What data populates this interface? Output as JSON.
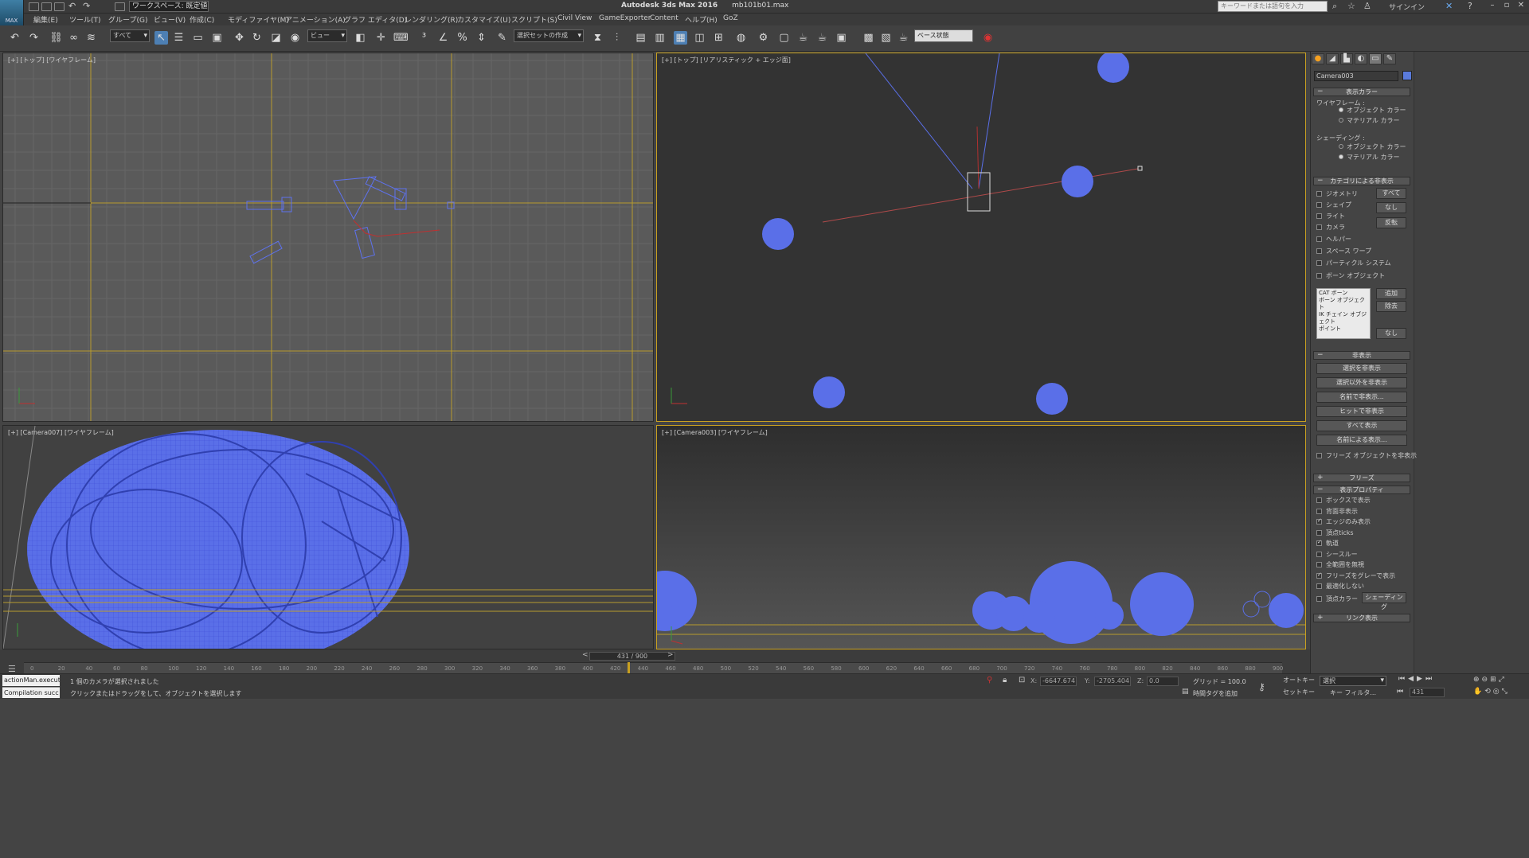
{
  "app": {
    "logo_text": "MAX",
    "workspace": "ワークスペース: 既定値",
    "title": "Autodesk 3ds Max 2016",
    "filename": "mb101b01.max",
    "search_placeholder": "キーワードまたは語句を入力",
    "signin": "サインイン"
  },
  "menu": [
    "編集(E)",
    "ツール(T)",
    "グループ(G)",
    "ビュー(V)",
    "作成(C)",
    "モディファイヤ(M)",
    "アニメーション(A)",
    "グラフ エディタ(D)",
    "レンダリング(R)",
    "カスタマイズ(U)",
    "スクリプト(S)",
    "Civil View",
    "GameExporter",
    "Content",
    "ヘルプ(H)",
    "GoZ"
  ],
  "toolbar": {
    "filter": "すべて",
    "view": "ビュー",
    "selection_set": "選択セットの作成",
    "render_state": "ベース状態"
  },
  "viewports": {
    "top_left": "[+] [トップ] [ワイヤフレーム]",
    "top_right": "[+] [トップ] [リアリスティック + エッジ面]",
    "bottom_left": "[+] [Camera007] [ワイヤフレーム]",
    "bottom_right": "[+] [Camera003] [ワイヤフレーム]"
  },
  "colors": {
    "object_blue": "#5a6fe8",
    "active_border": "#c8a020",
    "grid_yellow": "#b89b2e"
  },
  "timeline": {
    "frame": "431 / 900",
    "ticks": [
      "0",
      "20",
      "40",
      "60",
      "80",
      "100",
      "120",
      "140",
      "160",
      "180",
      "200",
      "220",
      "240",
      "260",
      "280",
      "300",
      "320",
      "340",
      "360",
      "380",
      "400",
      "420",
      "440",
      "460",
      "480",
      "500",
      "520",
      "540",
      "560",
      "580",
      "600",
      "620",
      "640",
      "660",
      "680",
      "700",
      "720",
      "740",
      "760",
      "780",
      "800",
      "820",
      "840",
      "860",
      "880",
      "900"
    ]
  },
  "status": {
    "maxscript_1": "actionMan.execut",
    "maxscript_2": "Compilation succ",
    "line1": "1 個のカメラが選択されました",
    "line2": "クリックまたはドラッグをして、オブジェクトを選択します",
    "x_label": "X:",
    "x": "-6647.674",
    "y_label": "Y:",
    "y": "-2705.404",
    "z_label": "Z:",
    "z": "0.0",
    "grid": "グリッド = 100.0",
    "time_tag": "時間タグを追加",
    "autokey": "オートキー",
    "setkey": "セットキー",
    "key_mode": "選択",
    "key_filter": "キー フィルタ...",
    "frame_field": "431"
  },
  "panel": {
    "object_name": "Camera003",
    "display_color": "表示カラー",
    "wireframe": "ワイヤフレーム :",
    "shaded": "シェーディング :",
    "object_color": "オブジェクト カラー",
    "material_color": "マテリアル カラー",
    "hide_by_category": "カテゴリによる非表示",
    "categories": [
      "ジオメトリ",
      "シェイプ",
      "ライト",
      "カメラ",
      "ヘルパー",
      "スペース ワープ",
      "パーティクル システム",
      "ボーン オブジェクト"
    ],
    "cat_buttons": [
      "すべて",
      "なし",
      "反転"
    ],
    "list_items": [
      "CAT ボーン",
      "ボーン オブジェクト",
      "IK チェイン オブジェクト",
      "ポイント"
    ],
    "list_buttons": [
      "追加",
      "除去",
      "なし"
    ],
    "hide": "非表示",
    "hide_buttons": [
      "選択を非表示",
      "選択以外を非表示",
      "名前で非表示...",
      "ヒットで非表示",
      "すべて表示",
      "名前による表示..."
    ],
    "hide_frozen": "フリーズ オブジェクトを非表示",
    "freeze": "フリーズ",
    "display_props": "表示プロパティ",
    "props": [
      "ボックスで表示",
      "背面非表示",
      "エッジのみ表示",
      "頂点ticks",
      "軌道",
      "シースルー",
      "全範囲を無視",
      "フリーズをグレーで表示",
      "最適化しない"
    ],
    "props_checked": [
      false,
      false,
      true,
      false,
      true,
      false,
      false,
      true,
      false
    ],
    "vertex_color": "頂点カラー",
    "shading_btn": "シェーディング",
    "link_display": "リンク表示"
  }
}
